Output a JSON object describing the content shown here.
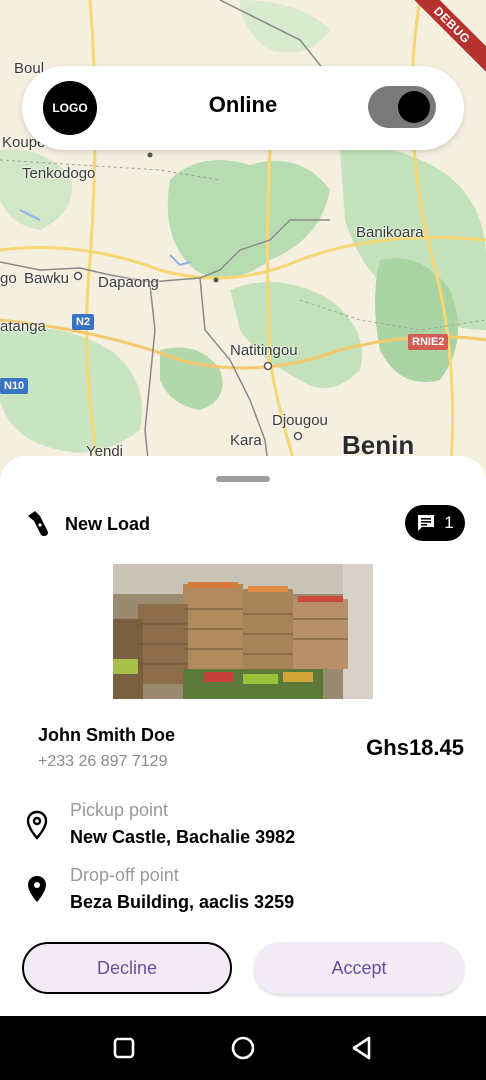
{
  "map": {
    "labels": {
      "boul": "Boul",
      "koupe": "Koupe",
      "tenkodogo": "Tenkodogo",
      "banikoara": "Banikoara",
      "bawku": "Bawku",
      "dapaong": "Dapaong",
      "go": "go",
      "atanga": "atanga",
      "natitingou": "Natitingou",
      "djougou": "Djougou",
      "kara": "Kara",
      "yendi": "Yendi",
      "benin": "Benin"
    },
    "shields": {
      "n2": "N2",
      "n10": "N10",
      "rnie2": "RNIE2"
    },
    "debug_banner": "DEBUG"
  },
  "top_card": {
    "logo_text": "LOGO",
    "status": "Online",
    "toggle_on": true
  },
  "sheet": {
    "icon": "flashlight-icon",
    "title": "New Load",
    "message_count": "1",
    "customer_name": "John Smith Doe",
    "customer_phone": "+233 26 897 7129",
    "price": "Ghs18.45",
    "pickup_label": "Pickup point",
    "pickup_value": "New Castle, Bachalie 3982",
    "dropoff_label": "Drop-off point",
    "dropoff_value": "Beza Building, aaclis 3259",
    "decline_label": "Decline",
    "accept_label": "Accept"
  },
  "colors": {
    "accent_text": "#6b4ea0",
    "button_bg": "#f3ecf6",
    "toggle_track": "#7a7a7a"
  }
}
